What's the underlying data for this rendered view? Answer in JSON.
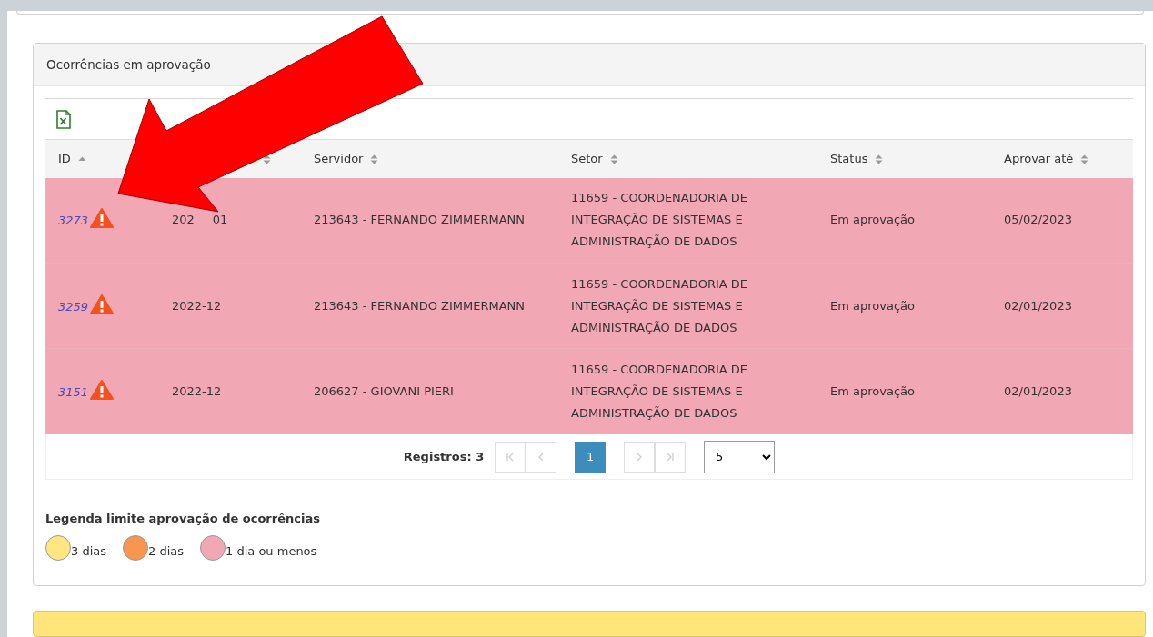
{
  "panel": {
    "title": "Ocorrências em aprovação"
  },
  "table": {
    "columns": [
      {
        "label": "ID",
        "sorted_ascending": true
      },
      {
        "sorted_ascending": false
      },
      {
        "label": "Servidor",
        "sorted_ascending": false
      },
      {
        "label": "Setor",
        "sorted_ascending": false
      },
      {
        "label": "Status",
        "sorted_ascending": false
      },
      {
        "label": "Aprovar até",
        "sorted_ascending": false
      }
    ],
    "rows": [
      {
        "id": "3273",
        "warning": true,
        "color": "#f2a7b5",
        "period_parts": [
          "202",
          "01"
        ],
        "servidor": "213643 - FERNANDO ZIMMERMANN",
        "setor": "11659 - COORDENADORIA DE INTEGRAÇÃO DE SISTEMAS E ADMINISTRAÇÃO DE DADOS",
        "status": "Em aprovação",
        "deadline": "05/02/2023"
      },
      {
        "id": "3259",
        "warning": true,
        "color": "#f2a7b5",
        "period": "2022-12",
        "servidor": "213643 - FERNANDO ZIMMERMANN",
        "setor": "11659 - COORDENADORIA DE INTEGRAÇÃO DE SISTEMAS E ADMINISTRAÇÃO DE DADOS",
        "status": "Em aprovação",
        "deadline": "02/01/2023"
      },
      {
        "id": "3151",
        "warning": true,
        "color": "#f2a7b5",
        "period": "2022-12",
        "servidor": "206627 - GIOVANI PIERI",
        "setor": "11659 - COORDENADORIA DE INTEGRAÇÃO DE SISTEMAS E ADMINISTRAÇÃO DE DADOS",
        "status": "Em aprovação",
        "deadline": "02/01/2023"
      }
    ]
  },
  "pagination": {
    "records": "Registros: 3",
    "pages": [
      {
        "label": "1",
        "selected": true
      }
    ],
    "first_disabled": true,
    "prev_disabled": true,
    "next_disabled": true,
    "last_disabled": true,
    "page_size": "5"
  },
  "legend": {
    "title": "Legenda limite aprovação de ocorrências",
    "items": [
      {
        "label": "3 dias",
        "color": "#ffe680"
      },
      {
        "label": "2 dias",
        "color": "#f7964f"
      },
      {
        "label": "1 dia ou menos",
        "color": "#f2a7b5"
      }
    ]
  }
}
